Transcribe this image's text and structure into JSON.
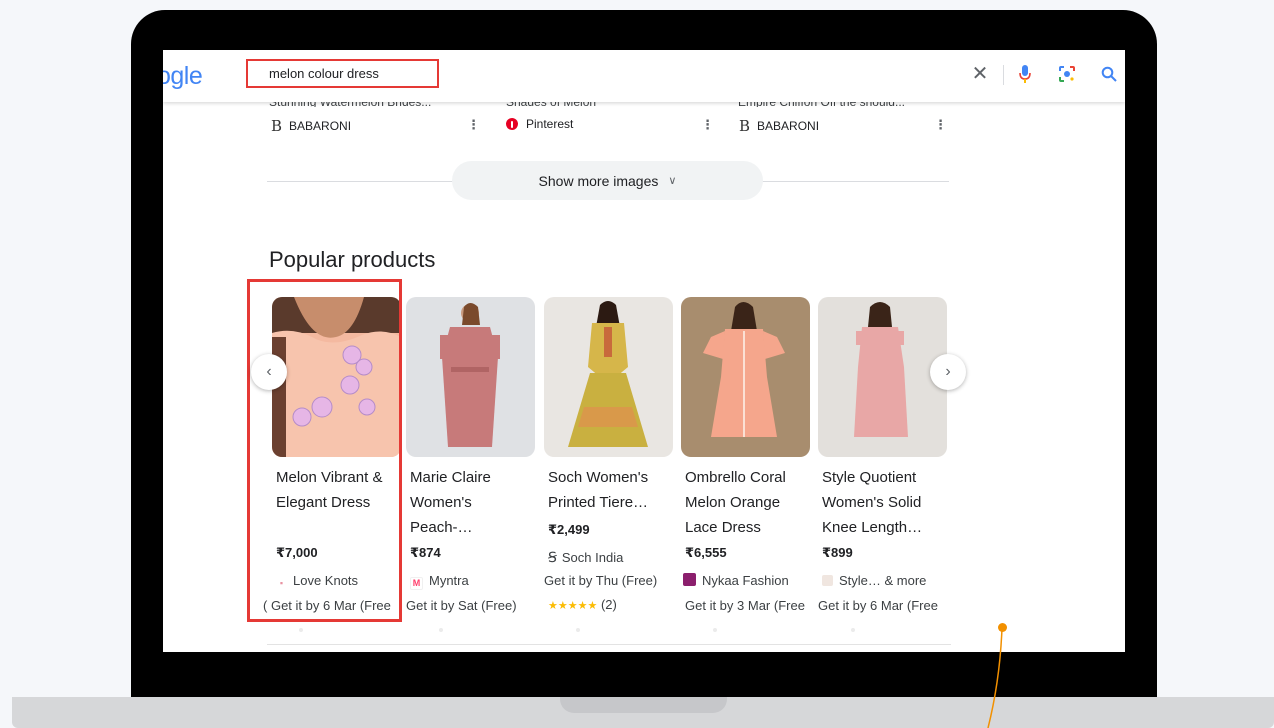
{
  "search": {
    "logo_partial": "ogle",
    "query": "melon colour dress"
  },
  "image_results": [
    {
      "title": "Stunning Watermelon Brides...",
      "source": "BABARONI"
    },
    {
      "title": "Shades of Melon",
      "source": "Pinterest"
    },
    {
      "title": "Empire Chiffon Off the should...",
      "source": "BABARONI"
    }
  ],
  "show_more_label": "Show more images",
  "popular_products": {
    "heading": "Popular products",
    "items": [
      {
        "name": "Melon Vibrant & Elegant Dress",
        "price": "₹7,000",
        "store": "Love Knots",
        "shipping": "Get it by 6 Mar (Free"
      },
      {
        "name": "Marie Claire Women's Peach-…",
        "price": "₹874",
        "store": "Myntra",
        "shipping": "Get it by Sat (Free)"
      },
      {
        "name": "Soch Women's Printed Tiere…",
        "price": "₹2,499",
        "store": "Soch India",
        "shipping": "Get it by Thu (Free)",
        "rating": "★★★★★",
        "reviews": "(2)"
      },
      {
        "name": "Ombrello Coral Melon Orange Lace Dress",
        "price": "₹6,555",
        "store": "Nykaa Fashion",
        "shipping": "Get it by 3 Mar (Free"
      },
      {
        "name": "Style Quotient Women's Solid Knee Length…",
        "price": "₹899",
        "store": "Style… & more",
        "shipping": "Get it by 6 Mar (Free"
      }
    ]
  },
  "colors": {
    "highlight": "#e53935",
    "annotation": "#f29000"
  }
}
